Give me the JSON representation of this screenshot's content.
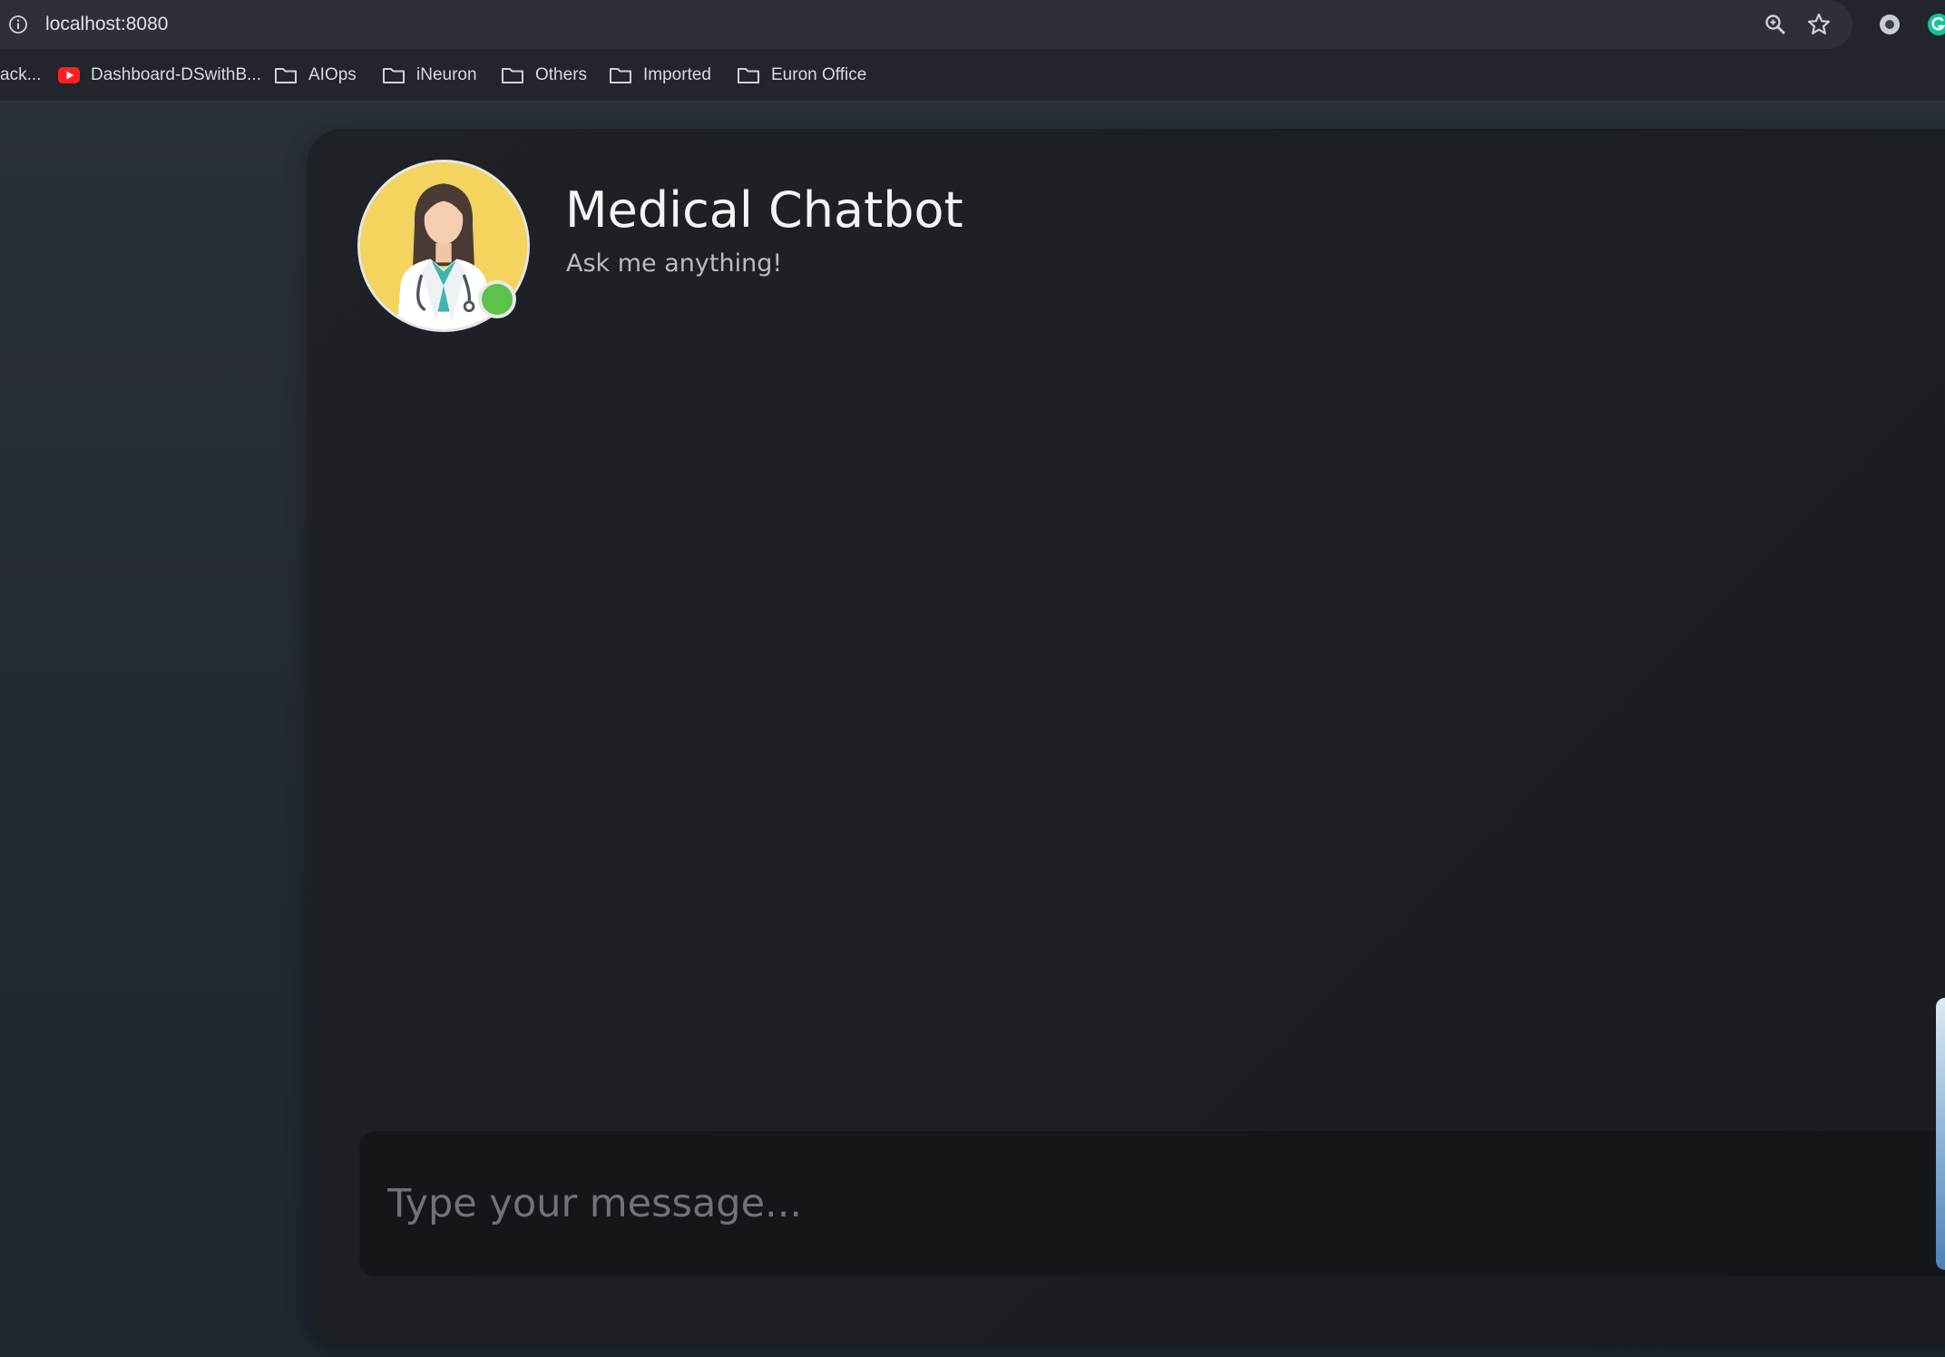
{
  "browser": {
    "url": "localhost:8080",
    "icons": {
      "site_info": "info-icon",
      "zoom": "zoom-icon",
      "bookmark_star": "star-icon",
      "extension": "extension-icon",
      "grammarly": "grammarly-icon"
    },
    "bookmarks": [
      {
        "label": "ack...",
        "icon": "none"
      },
      {
        "label": "Dashboard-DSwithB...",
        "icon": "youtube-icon"
      },
      {
        "label": "AIOps",
        "icon": "folder-icon"
      },
      {
        "label": "iNeuron",
        "icon": "folder-icon"
      },
      {
        "label": "Others",
        "icon": "folder-icon"
      },
      {
        "label": "Imported",
        "icon": "folder-icon"
      },
      {
        "label": "Euron Office",
        "icon": "folder-icon"
      }
    ]
  },
  "chat": {
    "title": "Medical Chatbot",
    "subtitle": "Ask me anything!",
    "avatar": "doctor-avatar",
    "status": "online",
    "input_placeholder": "Type your message...",
    "send_icon": "send-icon"
  },
  "colors": {
    "card_background": "#1c1f24",
    "online": "#5cc24a",
    "avatar_background": "#f4d35e"
  }
}
